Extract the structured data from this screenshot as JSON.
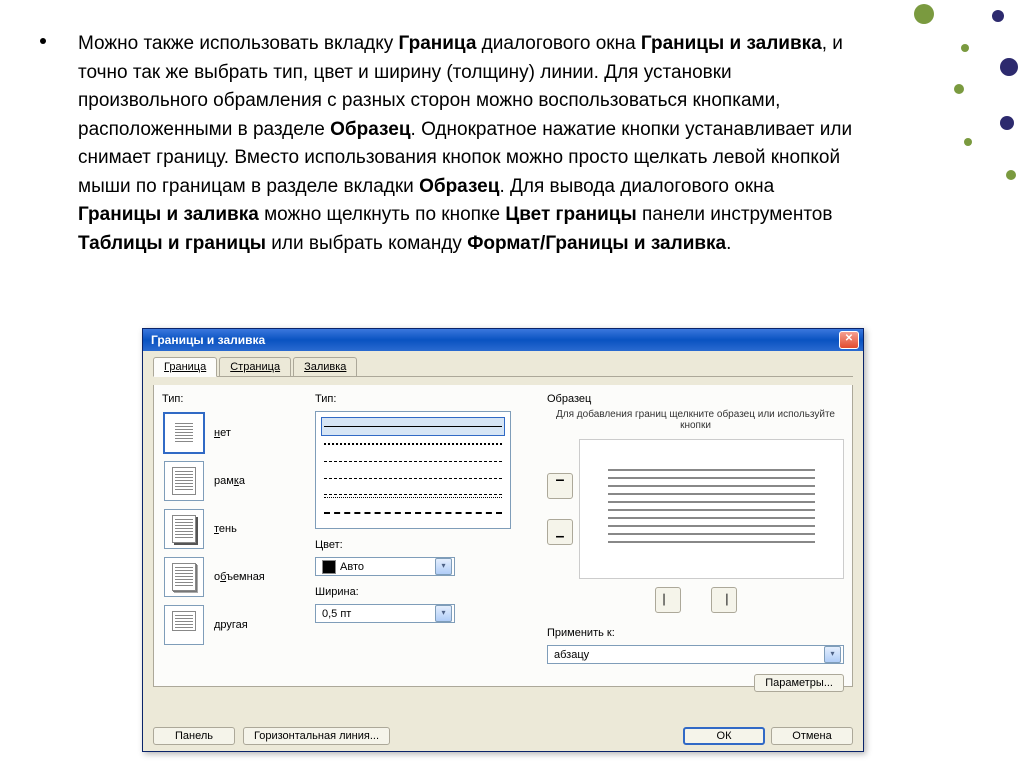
{
  "paragraph": {
    "parts": [
      {
        "t": "Можно также использовать вкладку ",
        "b": false
      },
      {
        "t": "Граница",
        "b": true
      },
      {
        "t": " диалогового окна ",
        "b": false
      },
      {
        "t": "Границы и заливка",
        "b": true
      },
      {
        "t": ", и точно так же выбрать тип, цвет и ширину (толщину) линии. Для установки произвольного обрамления с разных сторон можно воспользоваться кнопками, расположенными в разделе ",
        "b": false
      },
      {
        "t": "Образец",
        "b": true
      },
      {
        "t": ". Однократное нажатие кнопки устанавливает или снимает границу. Вместо использования кнопок можно просто щелкать левой кнопкой мыши по границам в разделе вкладки ",
        "b": false
      },
      {
        "t": "Образец",
        "b": true
      },
      {
        "t": ". Для вывода диалогового окна ",
        "b": false
      },
      {
        "t": "Границы и заливка",
        "b": true
      },
      {
        "t": " можно щелкнуть по кнопке ",
        "b": false
      },
      {
        "t": "Цвет границы",
        "b": true
      },
      {
        "t": " панели инструментов ",
        "b": false
      },
      {
        "t": "Таблицы и границы",
        "b": true
      },
      {
        "t": " или выбрать команду ",
        "b": false
      },
      {
        "t": "Формат/Границы и заливка",
        "b": true
      },
      {
        "t": ".",
        "b": false
      }
    ]
  },
  "dialog": {
    "title": "Границы и заливка",
    "tabs": [
      "Граница",
      "Страница",
      "Заливка"
    ],
    "active_tab": 0,
    "type_label": "Тип:",
    "type_items": [
      {
        "label": "нет",
        "ul": "н"
      },
      {
        "label": "рамка",
        "ul": "к"
      },
      {
        "label": "тень",
        "ul": "т"
      },
      {
        "label": "объемная",
        "ul": "б"
      },
      {
        "label": "другая",
        "ul": "д"
      }
    ],
    "linestyle_label": "Тип:",
    "color_label": "Цвет:",
    "color_value": "Авто",
    "width_label": "Ширина:",
    "width_value": "0,5 пт",
    "preview_label": "Образец",
    "preview_hint": "Для добавления границ щелкните образец или используйте кнопки",
    "apply_label": "Применить к:",
    "apply_value": "абзацу",
    "options_btn": "Параметры...",
    "panel_btn": "Панель",
    "hline_btn": "Горизонтальная линия...",
    "ok_btn": "ОК",
    "cancel_btn": "Отмена"
  }
}
